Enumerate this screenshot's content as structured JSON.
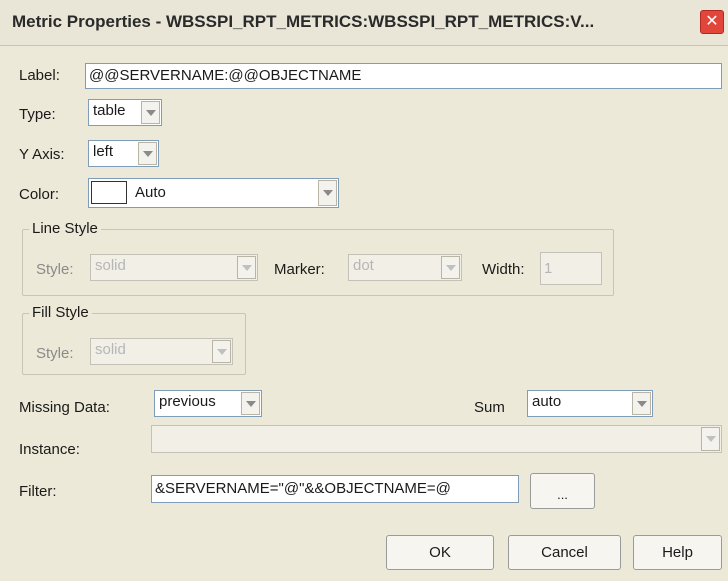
{
  "window": {
    "title": "Metric Properties - WBSSPI_RPT_METRICS:WBSSPI_RPT_METRICS:V...",
    "close_glyph": "✕"
  },
  "label": {
    "caption": "Label:",
    "value": "@@SERVERNAME:@@OBJECTNAME"
  },
  "type": {
    "caption": "Type:",
    "value": "table"
  },
  "yaxis": {
    "caption": "Y Axis:",
    "value": "left"
  },
  "color": {
    "caption": "Color:",
    "value": "Auto"
  },
  "line_style": {
    "group_title": "Line Style",
    "style_caption": "Style:",
    "style_value": "solid",
    "marker_caption": "Marker:",
    "marker_value": "dot",
    "width_caption": "Width:",
    "width_value": "1"
  },
  "fill_style": {
    "group_title": "Fill Style",
    "style_caption": "Style:",
    "style_value": "solid"
  },
  "missing_data": {
    "caption": "Missing Data:",
    "value": "previous"
  },
  "sum": {
    "caption": "Sum",
    "value": "auto"
  },
  "instance": {
    "caption": "Instance:",
    "value": ""
  },
  "filter": {
    "caption": "Filter:",
    "value": "&SERVERNAME=\"@\"&&OBJECTNAME=@",
    "browse_label": "..."
  },
  "buttons": {
    "ok": "OK",
    "cancel": "Cancel",
    "help": "Help"
  },
  "colors": {
    "window_bg": "#ece9d8",
    "field_border": "#7f9db9",
    "close_red": "#e2463a"
  }
}
